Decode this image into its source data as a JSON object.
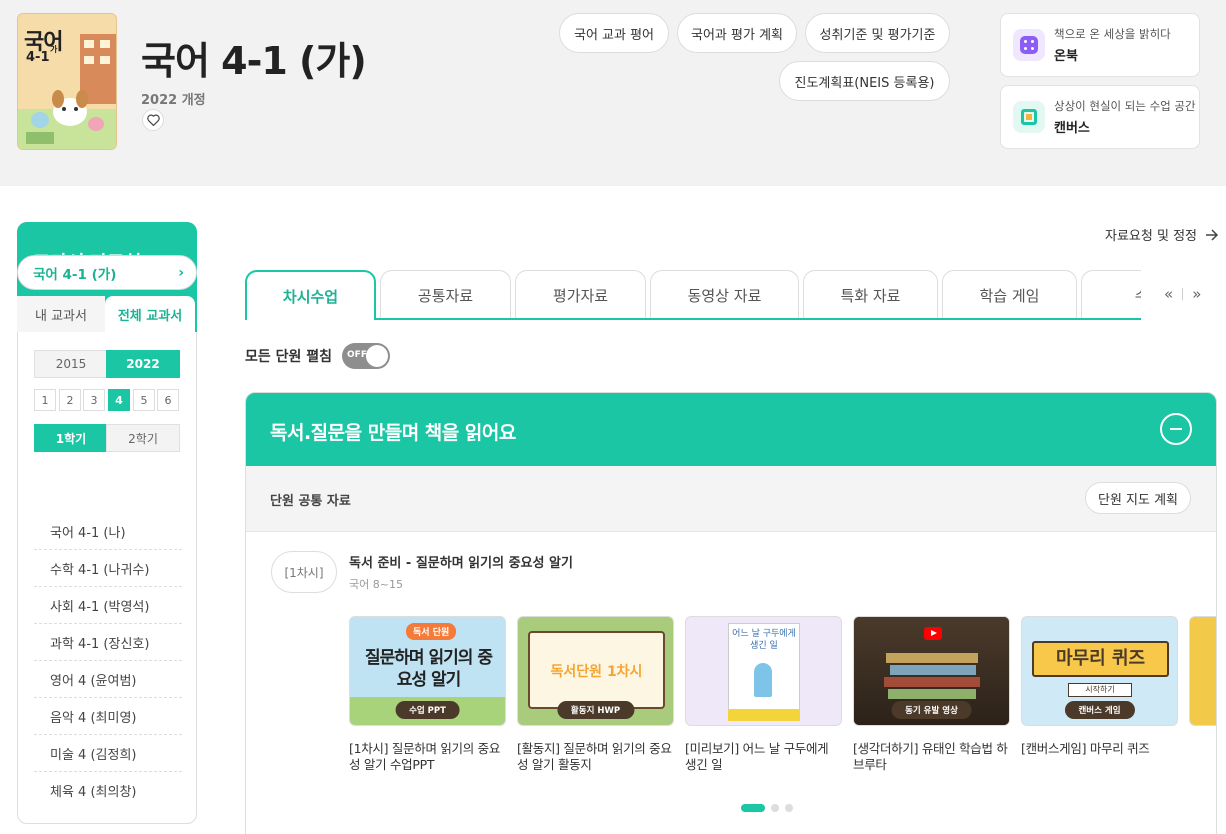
{
  "book": {
    "title": "국어 4-1 (가)",
    "edition": "2022 개정",
    "cover_text": "국어",
    "cover_sub": "4-1",
    "cover_mark": "가"
  },
  "header_links": {
    "subject_eval": "국어 교과 평어",
    "eval_plan": "국어과 평가 계획",
    "standards": "성취기준 및 평가기준",
    "progress": "진도계획표(NEIS 등록용)"
  },
  "promos": [
    {
      "sub": "책으로 온 세상을 밝히다",
      "name": "온북",
      "icon": "onbook-icon",
      "color": "#8b5cf6"
    },
    {
      "sub": "상상이 현실이 되는 수업 공간",
      "name": "캔버스",
      "icon": "canvas-icon",
      "color": "#1ac6a4"
    }
  ],
  "sidebar": {
    "title": "교과서 자료실",
    "tab_my": "내 교과서",
    "tab_all": "전체 교과서",
    "years": [
      "2015",
      "2022"
    ],
    "selected_year": "2022",
    "grades": [
      "1",
      "2",
      "3",
      "4",
      "5",
      "6"
    ],
    "selected_grade": "4",
    "semesters": [
      "1학기",
      "2학기"
    ],
    "selected_semester": "1학기",
    "active_book": "국어 4-1 (가)",
    "books": [
      "국어 4-1 (나)",
      "수학 4-1 (나귀수)",
      "사회 4-1 (박영석)",
      "과학 4-1 (장신호)",
      "영어 4 (윤여범)",
      "음악 4 (최미영)",
      "미술 4 (김정희)",
      "체육 4 (최의창)"
    ]
  },
  "main": {
    "request_link": "자료요청 및 정정",
    "tabs": [
      "차시수업",
      "공통자료",
      "평가자료",
      "동영상 자료",
      "특화 자료",
      "학습 게임",
      "수학"
    ],
    "active_tab": "차시수업",
    "toggle_label": "모든 단원 펼침",
    "toggle_state": "OFF",
    "unit_title": "독서.질문을 만들며 책을 읽어요",
    "common_label": "단원 공통 자료",
    "plan_button": "단원 지도 계획",
    "session_badge": "[1차시]",
    "lesson_title": "독서 준비 - 질문하며 읽기의 중요성 알기",
    "lesson_pages": "국어 8~15",
    "cards": [
      {
        "caption": "[1차시] 질문하며 읽기의 중요성 알기 수업PPT",
        "thumb_badge": "독서 단원",
        "thumb_title": "질문하며 읽기의 중요성 알기",
        "thumb_chip": "수업 PPT"
      },
      {
        "caption": "[활동지] 질문하며 읽기의 중요성 알기 활동지",
        "thumb_title": "독서단원 1차시",
        "thumb_chip": "활동지 HWP"
      },
      {
        "caption": "[미리보기] 어느 날 구두에게 생긴 일",
        "thumb_title": "어느 날 구두에게 생긴 일"
      },
      {
        "caption": "[생각더하기] 유태인 학습법 하브루타",
        "thumb_chip": "동기 유발 영상"
      },
      {
        "caption": "[캔버스게임] 마무리 퀴즈",
        "thumb_title": "마무리 퀴즈",
        "thumb_button": "시작하기",
        "thumb_chip": "캔버스 게임"
      }
    ],
    "pagination": {
      "pages": 3,
      "current": 1
    }
  }
}
